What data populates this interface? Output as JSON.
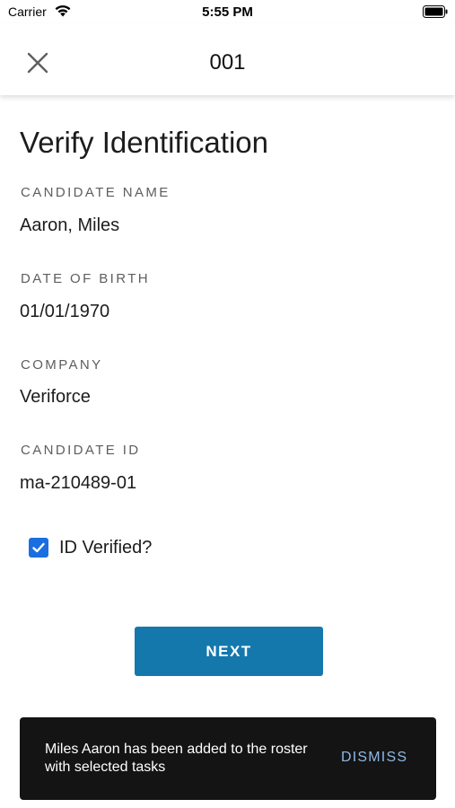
{
  "status_bar": {
    "carrier": "Carrier",
    "time": "5:55 PM"
  },
  "header": {
    "title": "001",
    "close_icon": "close-icon"
  },
  "page_title": "Verify Identification",
  "fields": [
    {
      "label": "CANDIDATE NAME",
      "value": "Aaron, Miles"
    },
    {
      "label": "DATE OF BIRTH",
      "value": "01/01/1970"
    },
    {
      "label": "COMPANY",
      "value": "Veriforce"
    },
    {
      "label": "CANDIDATE ID",
      "value": "ma-210489-01"
    }
  ],
  "id_verified": {
    "label": "ID Verified?",
    "checked": true
  },
  "next_button": {
    "label": "NEXT"
  },
  "snackbar": {
    "message": "Miles Aaron has been added to the roster with selected tasks",
    "action": "DISMISS"
  },
  "colors": {
    "primary_button": "#1478ad",
    "checkbox": "#1a6fe0",
    "snackbar_bg": "#141414",
    "snackbar_action": "#8fb9e6"
  }
}
